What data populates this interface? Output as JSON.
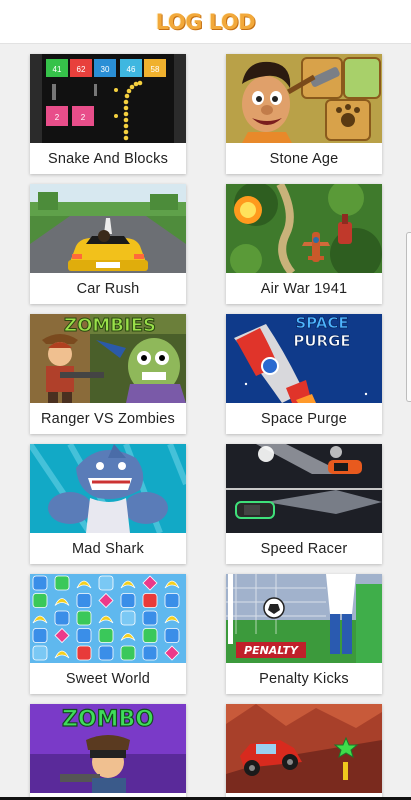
{
  "header": {
    "logo": "LOG LOD"
  },
  "games": [
    {
      "title": "Snake And Blocks",
      "icon": "snake-blocks-thumbnail",
      "blocks": [
        "41",
        "62",
        "30",
        "46",
        "58",
        "2",
        "2"
      ]
    },
    {
      "title": "Stone Age",
      "icon": "stone-age-thumbnail"
    },
    {
      "title": "Car Rush",
      "icon": "car-rush-thumbnail"
    },
    {
      "title": "Air War 1941",
      "icon": "air-war-thumbnail"
    },
    {
      "title": "Ranger VS Zombies",
      "icon": "ranger-zombies-thumbnail",
      "art_text": "ZOMBIES"
    },
    {
      "title": "Space Purge",
      "icon": "space-purge-thumbnail",
      "art_text_1": "SPACE",
      "art_text_2": "PURGE"
    },
    {
      "title": "Mad Shark",
      "icon": "mad-shark-thumbnail"
    },
    {
      "title": "Speed Racer",
      "icon": "speed-racer-thumbnail"
    },
    {
      "title": "Sweet World",
      "icon": "sweet-world-thumbnail"
    },
    {
      "title": "Penalty Kicks",
      "icon": "penalty-kicks-thumbnail",
      "art_text": "PENALTY"
    },
    {
      "title": "",
      "icon": "zombo-thumbnail",
      "art_text": "ZOMBO"
    },
    {
      "title": "",
      "icon": "red-car-hill-thumbnail"
    }
  ],
  "colors": {
    "logo": "#f2a93b",
    "background": "#f0f0f0",
    "card": "#ffffff",
    "title_text": "#222222"
  }
}
